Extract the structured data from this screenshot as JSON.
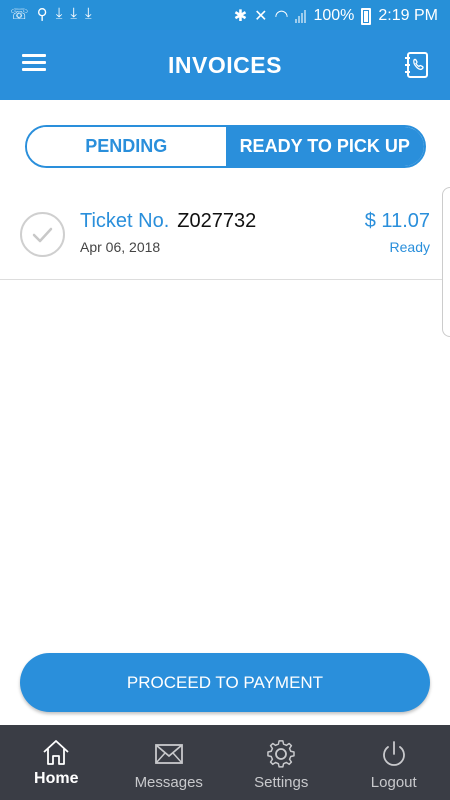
{
  "status_bar": {
    "battery": "100%",
    "time": "2:19 PM"
  },
  "app_bar": {
    "title": "INVOICES"
  },
  "tabs": [
    {
      "label": "PENDING",
      "active": false
    },
    {
      "label": "READY TO PICK UP",
      "active": true
    }
  ],
  "invoices": [
    {
      "ticket_label": "Ticket No.",
      "ticket_number": "Z027732",
      "date": "Apr 06, 2018",
      "amount": "$ 11.07",
      "status": "Ready"
    }
  ],
  "proceed_button": {
    "label": "PROCEED TO PAYMENT"
  },
  "bottom_nav": [
    {
      "label": "Home",
      "icon": "home-icon",
      "active": true
    },
    {
      "label": "Messages",
      "icon": "envelope-icon",
      "active": false
    },
    {
      "label": "Settings",
      "icon": "gear-icon",
      "active": false
    },
    {
      "label": "Logout",
      "icon": "power-icon",
      "active": false
    }
  ],
  "colors": {
    "primary": "#2a8fdb",
    "status_bar": "#2790d8",
    "nav_background": "#3a3d45"
  }
}
